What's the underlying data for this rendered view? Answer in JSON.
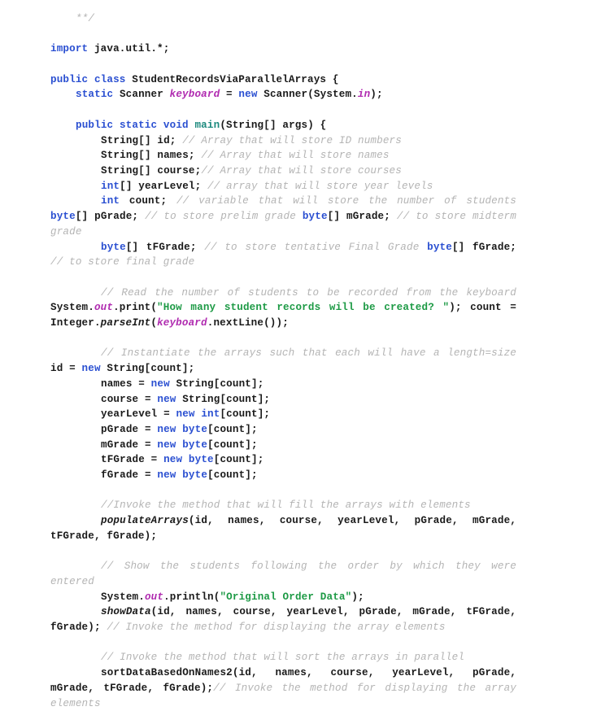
{
  "document": {
    "type": "source-code-listing",
    "language": "java",
    "class_name": "StudentRecordsViaParallelArrays",
    "colors": {
      "background": "#ffffff",
      "text": "#1a1a1a",
      "keyword": "#2a4fd1",
      "string": "#1d9a45",
      "comment": "#b4b4b4",
      "field": "#b02bb0",
      "method": "#1d8a7e"
    }
  },
  "lines": [
    {
      "id": "l01",
      "indent": 1,
      "tokens": [
        {
          "t": "cmt",
          "s": "**/"
        }
      ]
    },
    {
      "id": "l02",
      "blank": true,
      "tokens": []
    },
    {
      "id": "l03",
      "indent": 0,
      "tokens": [
        {
          "t": "kw",
          "s": "import"
        },
        {
          "t": "pln",
          "s": " java.util.*;"
        }
      ]
    },
    {
      "id": "l04",
      "blank": true,
      "tokens": []
    },
    {
      "id": "l05",
      "indent": 0,
      "tokens": [
        {
          "t": "kw",
          "s": "public class"
        },
        {
          "t": "pln",
          "s": " StudentRecordsViaParallelArrays {"
        }
      ]
    },
    {
      "id": "l06",
      "indent": 1,
      "tokens": [
        {
          "t": "kw",
          "s": "static"
        },
        {
          "t": "pln",
          "s": " Scanner "
        },
        {
          "t": "fld",
          "s": "keyboard"
        },
        {
          "t": "pln",
          "s": " = "
        },
        {
          "t": "kw",
          "s": "new"
        },
        {
          "t": "pln",
          "s": " Scanner(System."
        },
        {
          "t": "fld",
          "s": "in"
        },
        {
          "t": "pln",
          "s": ");"
        }
      ]
    },
    {
      "id": "l07",
      "blank": true,
      "tokens": []
    },
    {
      "id": "l08",
      "indent": 1,
      "tokens": [
        {
          "t": "kw",
          "s": "public static void"
        },
        {
          "t": "pln",
          "s": " "
        },
        {
          "t": "mth",
          "s": "main"
        },
        {
          "t": "pln",
          "s": "(String[] args) {"
        }
      ]
    },
    {
      "id": "l09",
      "indent": 2,
      "tokens": [
        {
          "t": "pln",
          "s": "String[] id; "
        },
        {
          "t": "cmt",
          "s": "// Array that will store ID numbers"
        }
      ]
    },
    {
      "id": "l10",
      "indent": 2,
      "tokens": [
        {
          "t": "pln",
          "s": "String[] names; "
        },
        {
          "t": "cmt",
          "s": "// Array that will store names"
        }
      ]
    },
    {
      "id": "l11",
      "indent": 2,
      "tokens": [
        {
          "t": "pln",
          "s": "String[] course;"
        },
        {
          "t": "cmt",
          "s": "// Array that will store courses"
        }
      ]
    },
    {
      "id": "l12",
      "indent": 2,
      "tokens": [
        {
          "t": "kw",
          "s": "int"
        },
        {
          "t": "pln",
          "s": "[] yearLevel; "
        },
        {
          "t": "cmt",
          "s": "// array that will store year levels"
        }
      ]
    },
    {
      "id": "l13",
      "indent": 2,
      "wrap": true,
      "tokens": [
        {
          "t": "kw",
          "s": "int"
        },
        {
          "t": "pln",
          "s": " count; "
        },
        {
          "t": "cmt",
          "s": "// variable that will store the number of students "
        },
        {
          "t": "kw",
          "s": "byte"
        },
        {
          "t": "pln",
          "s": "[] pGrade; "
        },
        {
          "t": "cmt",
          "s": "// to store prelim grade "
        },
        {
          "t": "kw",
          "s": "byte"
        },
        {
          "t": "pln",
          "s": "[] mGrade; "
        },
        {
          "t": "cmt",
          "s": "// to store midterm grade"
        }
      ]
    },
    {
      "id": "l14",
      "indent": 2,
      "wrap": true,
      "tokens": [
        {
          "t": "kw",
          "s": "byte"
        },
        {
          "t": "pln",
          "s": "[] tFGrade; "
        },
        {
          "t": "cmt",
          "s": "// to store tentative Final Grade "
        },
        {
          "t": "kw",
          "s": "byte"
        },
        {
          "t": "pln",
          "s": "[] fGrade; "
        },
        {
          "t": "cmt",
          "s": "// to store final grade"
        }
      ]
    },
    {
      "id": "l15",
      "blank": true,
      "tokens": []
    },
    {
      "id": "l16",
      "indent": 2,
      "wrap": true,
      "tokens": [
        {
          "t": "cmt",
          "s": "// Read the number of students to be recorded from the keyboard "
        },
        {
          "t": "pln",
          "s": "System."
        },
        {
          "t": "fld",
          "s": "out"
        },
        {
          "t": "pln",
          "s": ".print("
        },
        {
          "t": "str",
          "s": "\"How many student records will be created? \""
        },
        {
          "t": "pln",
          "s": "); count = Integer."
        },
        {
          "t": "mcall",
          "s": "parseInt"
        },
        {
          "t": "pln",
          "s": "("
        },
        {
          "t": "fld",
          "s": "keyboard"
        },
        {
          "t": "pln",
          "s": ".nextLine());"
        }
      ]
    },
    {
      "id": "l17",
      "blank": true,
      "tokens": []
    },
    {
      "id": "l18",
      "indent": 2,
      "wrap": true,
      "tokens": [
        {
          "t": "cmt",
          "s": "// Instantiate the arrays such that each will have a length=size "
        },
        {
          "t": "pln",
          "s": "id = "
        },
        {
          "t": "kw",
          "s": "new"
        },
        {
          "t": "pln",
          "s": " String[count];"
        }
      ]
    },
    {
      "id": "l19",
      "indent": 2,
      "tokens": [
        {
          "t": "pln",
          "s": "names = "
        },
        {
          "t": "kw",
          "s": "new"
        },
        {
          "t": "pln",
          "s": " String[count];"
        }
      ]
    },
    {
      "id": "l20",
      "indent": 2,
      "tokens": [
        {
          "t": "pln",
          "s": "course = "
        },
        {
          "t": "kw",
          "s": "new"
        },
        {
          "t": "pln",
          "s": " String[count];"
        }
      ]
    },
    {
      "id": "l21",
      "indent": 2,
      "tokens": [
        {
          "t": "pln",
          "s": "yearLevel = "
        },
        {
          "t": "kw",
          "s": "new"
        },
        {
          "t": "pln",
          "s": " "
        },
        {
          "t": "kw",
          "s": "int"
        },
        {
          "t": "pln",
          "s": "[count];"
        }
      ]
    },
    {
      "id": "l22",
      "indent": 2,
      "tokens": [
        {
          "t": "pln",
          "s": "pGrade = "
        },
        {
          "t": "kw",
          "s": "new"
        },
        {
          "t": "pln",
          "s": " "
        },
        {
          "t": "kw",
          "s": "byte"
        },
        {
          "t": "pln",
          "s": "[count];"
        }
      ]
    },
    {
      "id": "l23",
      "indent": 2,
      "tokens": [
        {
          "t": "pln",
          "s": "mGrade = "
        },
        {
          "t": "kw",
          "s": "new"
        },
        {
          "t": "pln",
          "s": " "
        },
        {
          "t": "kw",
          "s": "byte"
        },
        {
          "t": "pln",
          "s": "[count];"
        }
      ]
    },
    {
      "id": "l24",
      "indent": 2,
      "tokens": [
        {
          "t": "pln",
          "s": "tFGrade = "
        },
        {
          "t": "kw",
          "s": "new"
        },
        {
          "t": "pln",
          "s": " "
        },
        {
          "t": "kw",
          "s": "byte"
        },
        {
          "t": "pln",
          "s": "[count];"
        }
      ]
    },
    {
      "id": "l25",
      "indent": 2,
      "tokens": [
        {
          "t": "pln",
          "s": "fGrade = "
        },
        {
          "t": "kw",
          "s": "new"
        },
        {
          "t": "pln",
          "s": " "
        },
        {
          "t": "kw",
          "s": "byte"
        },
        {
          "t": "pln",
          "s": "[count];"
        }
      ]
    },
    {
      "id": "l26",
      "blank": true,
      "tokens": []
    },
    {
      "id": "l27",
      "indent": 2,
      "tokens": [
        {
          "t": "cmt",
          "s": "//Invoke the method that will fill the arrays with elements"
        }
      ]
    },
    {
      "id": "l28",
      "indent": 2,
      "wrap": true,
      "tokens": [
        {
          "t": "mcall",
          "s": "populateArrays"
        },
        {
          "t": "pln",
          "s": "(id, names, course, yearLevel, pGrade, mGrade, tFGrade, fGrade);"
        }
      ]
    },
    {
      "id": "l29",
      "blank": true,
      "tokens": []
    },
    {
      "id": "l30",
      "indent": 2,
      "wrap": true,
      "tokens": [
        {
          "t": "cmt",
          "s": "// Show the students following the order by which they were entered"
        }
      ]
    },
    {
      "id": "l31",
      "indent": 2,
      "tokens": [
        {
          "t": "pln",
          "s": "System."
        },
        {
          "t": "fld",
          "s": "out"
        },
        {
          "t": "pln",
          "s": ".println("
        },
        {
          "t": "str",
          "s": "\"Original Order Data\""
        },
        {
          "t": "pln",
          "s": ");"
        }
      ]
    },
    {
      "id": "l32",
      "indent": 2,
      "wrap": true,
      "tokens": [
        {
          "t": "mcall",
          "s": "showData"
        },
        {
          "t": "pln",
          "s": "(id, names, course, yearLevel, pGrade, mGrade, tFGrade, fGrade); "
        },
        {
          "t": "cmt",
          "s": "// Invoke the method for displaying the array elements"
        }
      ]
    },
    {
      "id": "l33",
      "blank": true,
      "tokens": []
    },
    {
      "id": "l34",
      "indent": 2,
      "tokens": [
        {
          "t": "cmt",
          "s": "// Invoke the method that will sort the arrays in parallel"
        }
      ]
    },
    {
      "id": "l35",
      "indent": 2,
      "wrap": true,
      "tokens": [
        {
          "t": "pln",
          "s": "sortDataBasedOnNames2(id, names, course, yearLevel, pGrade, mGrade, tFGrade, fGrade);"
        },
        {
          "t": "cmt",
          "s": "// Invoke the method for displaying the array elements"
        }
      ]
    }
  ]
}
